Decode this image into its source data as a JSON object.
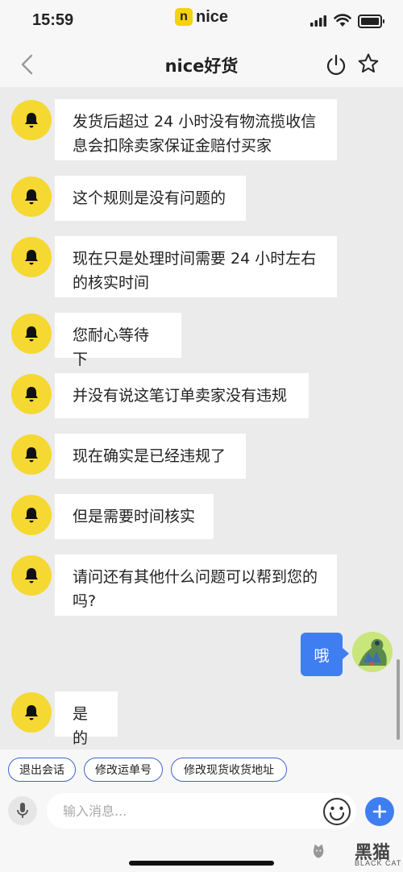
{
  "status_bar": {
    "time": "15:59",
    "brand": "nice",
    "brand_logo_letter": "n"
  },
  "header": {
    "title": "nice好货"
  },
  "messages": [
    {
      "from": "seller",
      "text": "发货后超过 24 小时没有物流揽收信息会扣除卖家保证金赔付买家"
    },
    {
      "from": "seller",
      "text": "这个规则是没有问题的"
    },
    {
      "from": "seller",
      "text": "现在只是处理时间需要 24 小时左右的核实时间"
    },
    {
      "from": "seller",
      "text": "您耐心等待下"
    },
    {
      "from": "seller",
      "text": "并没有说这笔订单卖家没有违规"
    },
    {
      "from": "seller",
      "text": "现在确实是已经违规了"
    },
    {
      "from": "seller",
      "text": "但是需要时间核实"
    },
    {
      "from": "seller",
      "text": "请问还有其他什么问题可以帮到您的吗?"
    },
    {
      "from": "user",
      "text": "哦"
    },
    {
      "from": "seller",
      "text": "是的"
    }
  ],
  "quick_actions": [
    "退出会话",
    "修改运单号",
    "修改现货收货地址"
  ],
  "input": {
    "placeholder": "输入消息..."
  },
  "watermark": {
    "text": "黑猫",
    "sub": "BLACK CAT"
  },
  "colors": {
    "accent": "#3f7ef1",
    "avatar_yellow": "#f5d832",
    "brand_yellow": "#f5d20a"
  }
}
